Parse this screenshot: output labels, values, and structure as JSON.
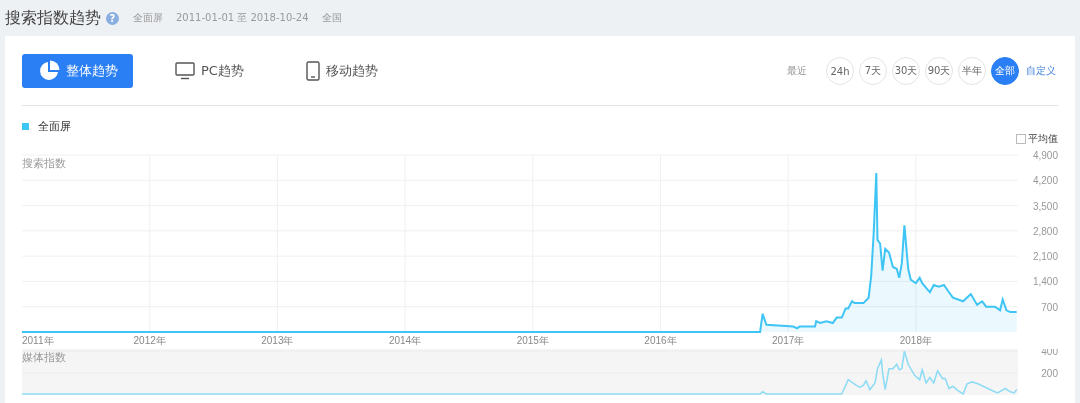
{
  "header": {
    "title": "搜索指数趋势",
    "help": "?",
    "meta": [
      "全面屏",
      "2011-01-01 至 2018-10-24",
      "全国"
    ]
  },
  "tabs": [
    {
      "label": "整体趋势",
      "selected": true
    },
    {
      "label": "PC趋势",
      "selected": false
    },
    {
      "label": "移动趋势",
      "selected": false
    }
  ],
  "range": {
    "label": "最近",
    "options": [
      {
        "label": "24h",
        "selected": false
      },
      {
        "label": "7天",
        "selected": false
      },
      {
        "label": "30天",
        "selected": false
      },
      {
        "label": "90天",
        "selected": false
      },
      {
        "label": "半年",
        "selected": false
      },
      {
        "label": "全部",
        "selected": true
      }
    ],
    "custom": "自定义"
  },
  "average": {
    "label": "平均值",
    "checked": false
  },
  "search_chart": {
    "chart_data": {
      "type": "area",
      "grid": true,
      "ylabel": "搜索指数",
      "xlim": [
        2011,
        2018.8
      ],
      "ylim": [
        0,
        4900
      ],
      "yticks": [
        {
          "value": 700,
          "label": "700"
        },
        {
          "value": 1400,
          "label": "1,400"
        },
        {
          "value": 2100,
          "label": "2,100"
        },
        {
          "value": 2800,
          "label": "2,800"
        },
        {
          "value": 3500,
          "label": "3,500"
        },
        {
          "value": 4200,
          "label": "4,200"
        },
        {
          "value": 4900,
          "label": "4,900"
        }
      ],
      "xticks": [
        {
          "value": 2011,
          "label": "2011年"
        },
        {
          "value": 2012,
          "label": "2012年"
        },
        {
          "value": 2013,
          "label": "2013年"
        },
        {
          "value": 2014,
          "label": "2014年"
        },
        {
          "value": 2015,
          "label": "2015年"
        },
        {
          "value": 2016,
          "label": "2016年"
        },
        {
          "value": 2017,
          "label": "2017年"
        },
        {
          "value": 2018,
          "label": "2018年"
        }
      ],
      "x": [
        2011.0,
        2016.78,
        2016.8,
        2016.83,
        2017.04,
        2017.07,
        2017.09,
        2017.21,
        2017.22,
        2017.25,
        2017.3,
        2017.35,
        2017.38,
        2017.42,
        2017.45,
        2017.47,
        2017.5,
        2017.52,
        2017.59,
        2017.63,
        2017.65,
        2017.67,
        2017.69,
        2017.7,
        2017.72,
        2017.74,
        2017.76,
        2017.79,
        2017.82,
        2017.85,
        2017.87,
        2017.89,
        2017.91,
        2017.94,
        2017.96,
        2018.0,
        2018.03,
        2018.05,
        2018.11,
        2018.14,
        2018.18,
        2018.22,
        2018.26,
        2018.29,
        2018.37,
        2018.43,
        2018.48,
        2018.52,
        2018.55,
        2018.62,
        2018.66,
        2018.68,
        2018.71,
        2018.74,
        2018.79
      ],
      "series": [
        {
          "name": "全面屏",
          "color": "#3ec5f5",
          "values": [
            0,
            0,
            500,
            200,
            150,
            100,
            150,
            150,
            300,
            250,
            300,
            250,
            400,
            400,
            650,
            650,
            850,
            800,
            800,
            950,
            1550,
            2750,
            4400,
            2550,
            2450,
            1700,
            2300,
            2200,
            1800,
            1750,
            1500,
            1900,
            2950,
            1750,
            1450,
            1350,
            1500,
            1350,
            1100,
            1300,
            1250,
            1300,
            1100,
            950,
            850,
            1050,
            750,
            850,
            700,
            700,
            600,
            900,
            600,
            550,
            550
          ]
        }
      ]
    }
  },
  "media_chart": {
    "chart_data": {
      "type": "line",
      "ylabel": "媒体指数",
      "xlim": [
        2011,
        2018.8
      ],
      "ylim": [
        0,
        400
      ],
      "yticks": [
        {
          "value": 200,
          "label": "200"
        },
        {
          "value": 400,
          "label": "400"
        }
      ],
      "x": [
        2011.0,
        2016.78,
        2016.8,
        2016.83,
        2017.42,
        2017.47,
        2017.52,
        2017.56,
        2017.59,
        2017.61,
        2017.64,
        2017.68,
        2017.7,
        2017.73,
        2017.74,
        2017.76,
        2017.79,
        2017.82,
        2017.85,
        2017.87,
        2017.89,
        2017.91,
        2017.94,
        2017.99,
        2018.03,
        2018.05,
        2018.08,
        2018.11,
        2018.14,
        2018.17,
        2018.21,
        2018.23,
        2018.26,
        2018.29,
        2018.33,
        2018.37,
        2018.4,
        2018.44,
        2018.49,
        2018.6,
        2018.64,
        2018.7,
        2018.74,
        2018.77,
        2018.79
      ],
      "series": [
        {
          "color": "#90dcf4",
          "values": [
            0,
            0,
            20,
            0,
            0,
            130,
            90,
            60,
            80,
            120,
            40,
            100,
            230,
            310,
            190,
            40,
            230,
            230,
            270,
            220,
            230,
            390,
            270,
            170,
            130,
            220,
            100,
            150,
            100,
            210,
            140,
            140,
            50,
            70,
            30,
            0,
            90,
            110,
            90,
            30,
            10,
            50,
            20,
            10,
            40
          ]
        }
      ]
    }
  }
}
